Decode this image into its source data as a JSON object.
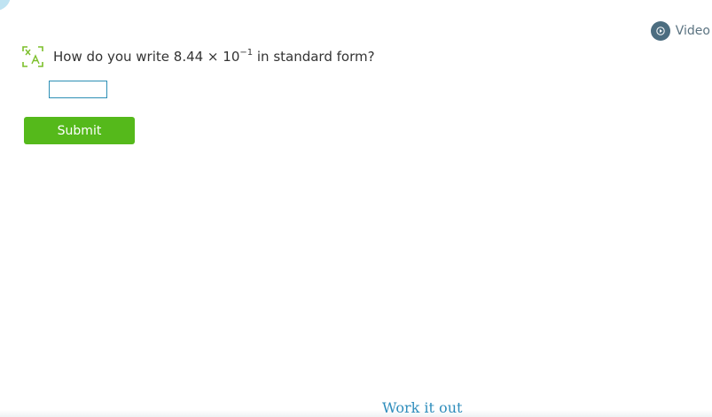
{
  "header": {
    "video_label": "Video"
  },
  "question": {
    "prefix": "How do you write 8.44 × 10",
    "exponent": "−1",
    "suffix": " in standard form?"
  },
  "answer": {
    "value": "",
    "placeholder": ""
  },
  "actions": {
    "submit_label": "Submit"
  },
  "footer": {
    "work_it_out_label": "Work it out"
  },
  "icons": {
    "video": "play-circle-icon",
    "translate": "translate-icon"
  },
  "colors": {
    "submit_green": "#55b91b",
    "link_blue": "#2e8dbc",
    "input_border": "#2d8fb5",
    "translate_green": "#7cbf2a",
    "video_icon_bg": "#4c6d80"
  }
}
